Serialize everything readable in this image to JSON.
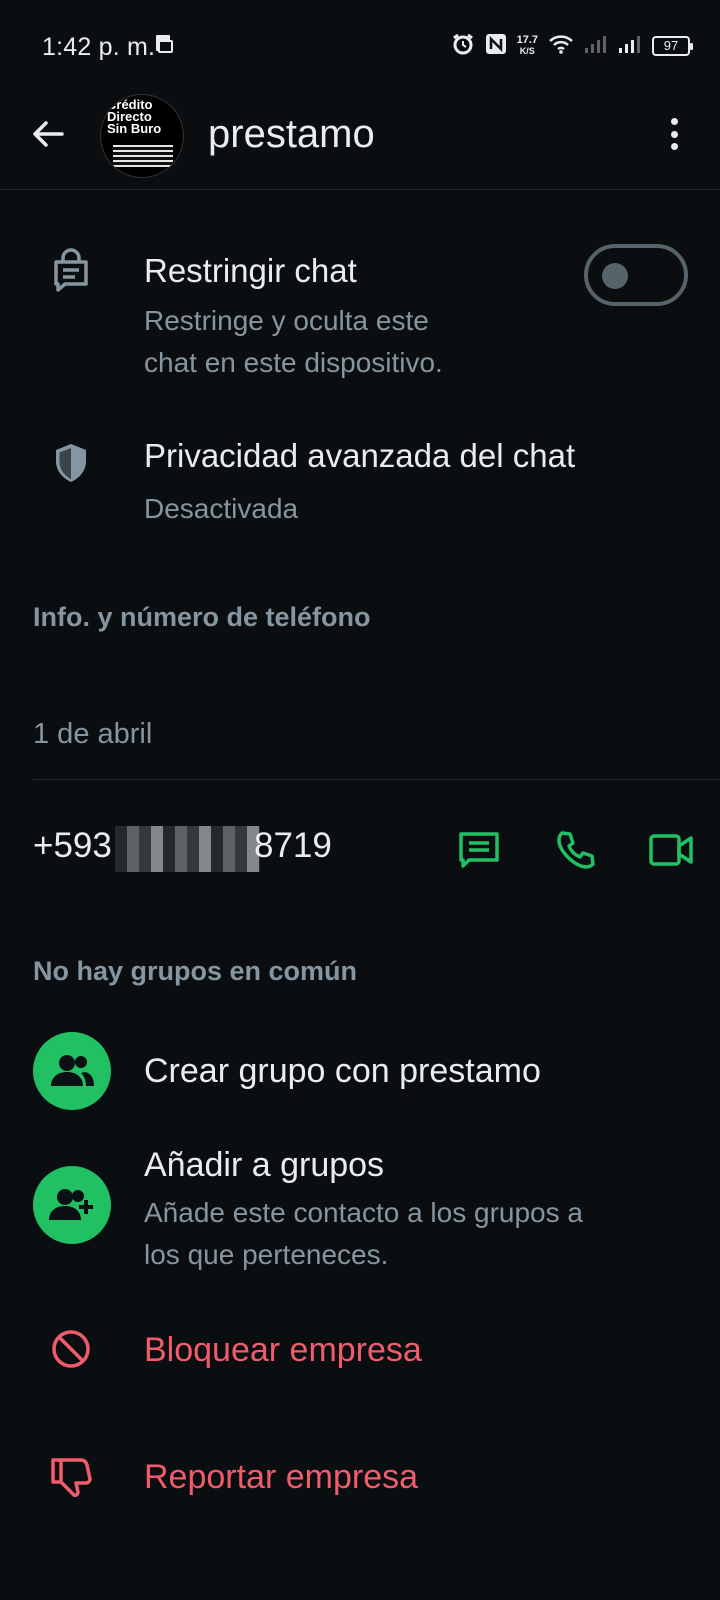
{
  "status_bar": {
    "time": "1:42 p. m.",
    "net_speed_value": "17.7",
    "net_speed_unit": "K/S",
    "battery": "97"
  },
  "header": {
    "title": "prestamo",
    "avatar_text": [
      "Crédito",
      "Directo",
      "Sin Buro"
    ]
  },
  "restrict_chat": {
    "title": "Restringir chat",
    "subtitle_line1": "Restringe y oculta este",
    "subtitle_line2": "chat en este dispositivo.",
    "enabled": false
  },
  "advanced_privacy": {
    "title": "Privacidad avanzada del chat",
    "status": "Desactivada"
  },
  "info_section": {
    "label": "Info. y número de teléfono",
    "date": "1 de abril",
    "phone": "+593",
    "phone_suffix": "8719"
  },
  "groups": {
    "label": "No hay grupos en común",
    "create_label": "Crear grupo con prestamo",
    "add_title": "Añadir a grupos",
    "add_subtitle_line1": "Añade este contacto a los grupos a",
    "add_subtitle_line2": "los que perteneces."
  },
  "actions": {
    "block": "Bloquear empresa",
    "report": "Reportar empresa"
  },
  "colors": {
    "background": "#0b0e11",
    "accent_green": "#21c063",
    "danger_red": "#f15c6d",
    "secondary_text": "#8696a0"
  }
}
